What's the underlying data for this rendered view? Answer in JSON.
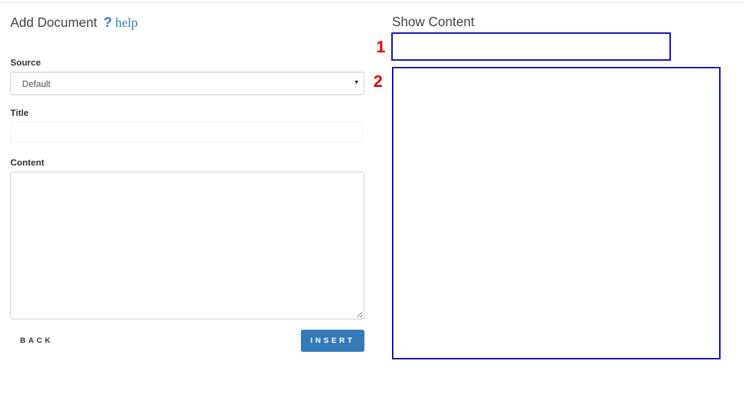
{
  "form": {
    "title": "Add Document",
    "help_icon": "?",
    "help_label": "help",
    "source_label": "Source",
    "source_value": "Default",
    "title_label": "Title",
    "title_value": "",
    "content_label": "Content",
    "content_value": "",
    "back_label": "BACK",
    "insert_label": "INSERT"
  },
  "preview": {
    "title": "Show Content",
    "marker_1": "1",
    "marker_2": "2"
  },
  "colors": {
    "accent": "#337ab7",
    "marker": "#e00000",
    "box_border": "#0000b0"
  },
  "icons": {
    "help": "question-mark-icon",
    "select_caret": "caret-down-icon",
    "resize": "resize-grip-icon"
  }
}
